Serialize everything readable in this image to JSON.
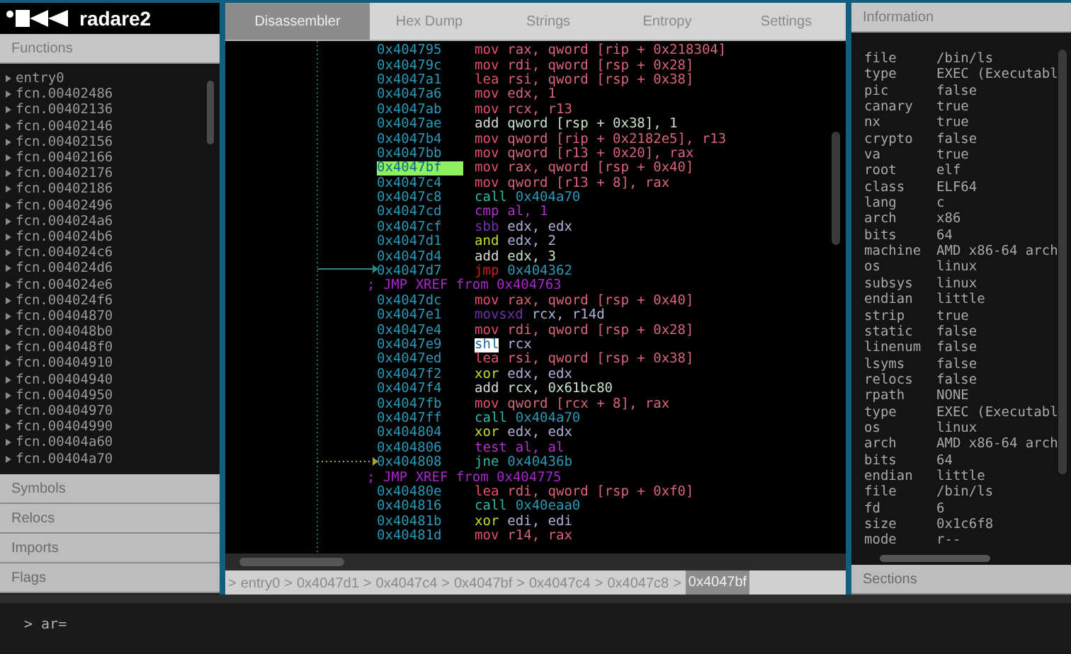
{
  "logo": {
    "text": "radare2"
  },
  "left_sections": [
    {
      "title": "Functions",
      "expanded": true
    },
    {
      "title": "Symbols",
      "expanded": false
    },
    {
      "title": "Relocs",
      "expanded": false
    },
    {
      "title": "Imports",
      "expanded": false
    },
    {
      "title": "Flags",
      "expanded": false
    }
  ],
  "functions": [
    "entry0",
    "fcn.00402486",
    "fcn.00402136",
    "fcn.00402146",
    "fcn.00402156",
    "fcn.00402166",
    "fcn.00402176",
    "fcn.00402186",
    "fcn.00402496",
    "fcn.004024a6",
    "fcn.004024b6",
    "fcn.004024c6",
    "fcn.004024d6",
    "fcn.004024e6",
    "fcn.004024f6",
    "fcn.00404870",
    "fcn.004048b0",
    "fcn.004048f0",
    "fcn.00404910",
    "fcn.00404940",
    "fcn.00404950",
    "fcn.00404970",
    "fcn.00404990",
    "fcn.00404a60",
    "fcn.00404a70"
  ],
  "tabs": [
    {
      "label": "Disassembler",
      "selected": true
    },
    {
      "label": "Hex Dump",
      "selected": false
    },
    {
      "label": "Strings",
      "selected": false
    },
    {
      "label": "Entropy",
      "selected": false
    },
    {
      "label": "Settings",
      "selected": false
    }
  ],
  "disassembly": [
    {
      "kind": "op",
      "addr": "0x404795",
      "mnemonic": "mov",
      "color": "#e0506a",
      "operands": "rax, qword [rip + 0x218304]",
      "selected": false,
      "highlighted": false
    },
    {
      "kind": "op",
      "addr": "0x40479c",
      "mnemonic": "mov",
      "color": "#e0506a",
      "operands": "rdi, qword [rsp + 0x28]",
      "selected": false,
      "highlighted": false
    },
    {
      "kind": "op",
      "addr": "0x4047a1",
      "mnemonic": "lea",
      "color": "#e0506a",
      "operands": "rsi, qword [rsp + 0x38]",
      "selected": false,
      "highlighted": false
    },
    {
      "kind": "op",
      "addr": "0x4047a6",
      "mnemonic": "mov",
      "color": "#e0506a",
      "operands": "edx, 1",
      "selected": false,
      "highlighted": false
    },
    {
      "kind": "op",
      "addr": "0x4047ab",
      "mnemonic": "mov",
      "color": "#e0506a",
      "operands": "rcx, r13",
      "selected": false,
      "highlighted": false
    },
    {
      "kind": "op",
      "addr": "0x4047ae",
      "mnemonic": "add",
      "color": "#d8d8d8",
      "operands": "qword [rsp + 0x38], 1",
      "selected": false,
      "highlighted": false
    },
    {
      "kind": "op",
      "addr": "0x4047b4",
      "mnemonic": "mov",
      "color": "#e0506a",
      "operands": "qword [rip + 0x2182e5], r13",
      "selected": false,
      "highlighted": false
    },
    {
      "kind": "op",
      "addr": "0x4047bb",
      "mnemonic": "mov",
      "color": "#e0506a",
      "operands": "qword [r13 + 0x20], rax",
      "selected": false,
      "highlighted": false
    },
    {
      "kind": "op",
      "addr": "0x4047bf",
      "mnemonic": "mov",
      "color": "#e0506a",
      "operands": "rax, qword [rsp + 0x40]",
      "selected": true,
      "highlighted": false
    },
    {
      "kind": "op",
      "addr": "0x4047c4",
      "mnemonic": "mov",
      "color": "#e0506a",
      "operands": "qword [r13 + 8], rax",
      "selected": false,
      "highlighted": false
    },
    {
      "kind": "op",
      "addr": "0x4047c8",
      "mnemonic": "call",
      "color": "#30b8a8",
      "operands": "0x404a70",
      "selected": false,
      "highlighted": false
    },
    {
      "kind": "op",
      "addr": "0x4047cd",
      "mnemonic": "cmp",
      "color": "#b030c8",
      "operands": "al, 1",
      "selected": false,
      "highlighted": false
    },
    {
      "kind": "op",
      "addr": "0x4047cf",
      "mnemonic": "sbb",
      "color": "#7030a8",
      "operands": "edx, edx",
      "selected": false,
      "highlighted": false
    },
    {
      "kind": "op",
      "addr": "0x4047d1",
      "mnemonic": "and",
      "color": "#c8d830",
      "operands": "edx, 2",
      "selected": false,
      "highlighted": false
    },
    {
      "kind": "op",
      "addr": "0x4047d4",
      "mnemonic": "add",
      "color": "#d8d8d8",
      "operands": "edx, 3",
      "selected": false,
      "highlighted": false
    },
    {
      "kind": "op",
      "addr": "0x4047d7",
      "mnemonic": "jmp",
      "color": "#c02020",
      "operands": "0x404362",
      "selected": false,
      "highlighted": false
    },
    {
      "kind": "xref",
      "text": "; JMP XREF from 0x404763"
    },
    {
      "kind": "op",
      "addr": "0x4047dc",
      "mnemonic": "mov",
      "color": "#e0506a",
      "operands": "rax, qword [rsp + 0x40]",
      "selected": false,
      "highlighted": false
    },
    {
      "kind": "op",
      "addr": "0x4047e1",
      "mnemonic": "movsxd",
      "color": "#7030a8",
      "operands": "rcx, r14d",
      "selected": false,
      "highlighted": false
    },
    {
      "kind": "op",
      "addr": "0x4047e4",
      "mnemonic": "mov",
      "color": "#e0506a",
      "operands": "rdi, qword [rsp + 0x28]",
      "selected": false,
      "highlighted": false
    },
    {
      "kind": "op",
      "addr": "0x4047e9",
      "mnemonic": "shl",
      "color": "#1a6a9a",
      "operands": "rcx",
      "selected": false,
      "highlighted": true
    },
    {
      "kind": "op",
      "addr": "0x4047ed",
      "mnemonic": "lea",
      "color": "#e0506a",
      "operands": "rsi, qword [rsp + 0x38]",
      "selected": false,
      "highlighted": false
    },
    {
      "kind": "op",
      "addr": "0x4047f2",
      "mnemonic": "xor",
      "color": "#c8d830",
      "operands": "edx, edx",
      "selected": false,
      "highlighted": false
    },
    {
      "kind": "op",
      "addr": "0x4047f4",
      "mnemonic": "add",
      "color": "#d8d8d8",
      "operands": "rcx, 0x61bc80",
      "selected": false,
      "highlighted": false
    },
    {
      "kind": "op",
      "addr": "0x4047fb",
      "mnemonic": "mov",
      "color": "#e0506a",
      "operands": "qword [rcx + 8], rax",
      "selected": false,
      "highlighted": false
    },
    {
      "kind": "op",
      "addr": "0x4047ff",
      "mnemonic": "call",
      "color": "#30b8a8",
      "operands": "0x404a70",
      "selected": false,
      "highlighted": false
    },
    {
      "kind": "op",
      "addr": "0x404804",
      "mnemonic": "xor",
      "color": "#c8d830",
      "operands": "edx, edx",
      "selected": false,
      "highlighted": false
    },
    {
      "kind": "op",
      "addr": "0x404806",
      "mnemonic": "test",
      "color": "#b030c8",
      "operands": "al, al",
      "selected": false,
      "highlighted": false
    },
    {
      "kind": "op",
      "addr": "0x404808",
      "mnemonic": "jne",
      "color": "#30b8a8",
      "operands": "0x40436b",
      "selected": false,
      "highlighted": false
    },
    {
      "kind": "xref",
      "text": "; JMP XREF from 0x404775"
    },
    {
      "kind": "op",
      "addr": "0x40480e",
      "mnemonic": "lea",
      "color": "#e0506a",
      "operands": "rdi, qword [rsp + 0xf0]",
      "selected": false,
      "highlighted": false
    },
    {
      "kind": "op",
      "addr": "0x404816",
      "mnemonic": "call",
      "color": "#30b8a8",
      "operands": "0x40eaa0",
      "selected": false,
      "highlighted": false
    },
    {
      "kind": "op",
      "addr": "0x40481b",
      "mnemonic": "xor",
      "color": "#c8d830",
      "operands": "edi, edi",
      "selected": false,
      "highlighted": false
    },
    {
      "kind": "op",
      "addr": "0x40481d",
      "mnemonic": "mov",
      "color": "#e0506a",
      "operands": "r14, rax",
      "selected": false,
      "highlighted": false
    }
  ],
  "breadcrumb": {
    "separator": ">",
    "items": [
      {
        "label": "entry0",
        "selected": false
      },
      {
        "label": "0x4047d1",
        "selected": false
      },
      {
        "label": "0x4047c4",
        "selected": false
      },
      {
        "label": "0x4047bf",
        "selected": false
      },
      {
        "label": "0x4047c4",
        "selected": false
      },
      {
        "label": "0x4047c8",
        "selected": false
      },
      {
        "label": "0x4047bf",
        "selected": true
      }
    ]
  },
  "right_sections": [
    {
      "title": "Information",
      "expanded": true
    },
    {
      "title": "Sections",
      "expanded": false
    }
  ],
  "information": [
    [
      "file",
      "/bin/ls"
    ],
    [
      "type",
      "EXEC (Executabl"
    ],
    [
      "pic",
      "false"
    ],
    [
      "canary",
      "true"
    ],
    [
      "nx",
      "true"
    ],
    [
      "crypto",
      "false"
    ],
    [
      "va",
      "true"
    ],
    [
      "root",
      "elf"
    ],
    [
      "class",
      "ELF64"
    ],
    [
      "lang",
      "c"
    ],
    [
      "arch",
      "x86"
    ],
    [
      "bits",
      "64"
    ],
    [
      "machine",
      "AMD x86-64 arch"
    ],
    [
      "os",
      "linux"
    ],
    [
      "subsys",
      "linux"
    ],
    [
      "endian",
      "little"
    ],
    [
      "strip",
      "true"
    ],
    [
      "static",
      "false"
    ],
    [
      "linenum",
      "false"
    ],
    [
      "lsyms",
      "false"
    ],
    [
      "relocs",
      "false"
    ],
    [
      "rpath",
      "NONE"
    ],
    [
      "type",
      "EXEC (Executabl"
    ],
    [
      "os",
      "linux"
    ],
    [
      "arch",
      "AMD x86-64 arch"
    ],
    [
      "bits",
      "64"
    ],
    [
      "endian",
      "little"
    ],
    [
      "file",
      "/bin/ls"
    ],
    [
      "fd",
      "6"
    ],
    [
      "size",
      "0x1c6f8"
    ],
    [
      "mode",
      "r--"
    ]
  ],
  "console": {
    "prompt": ">",
    "command": "ar="
  }
}
